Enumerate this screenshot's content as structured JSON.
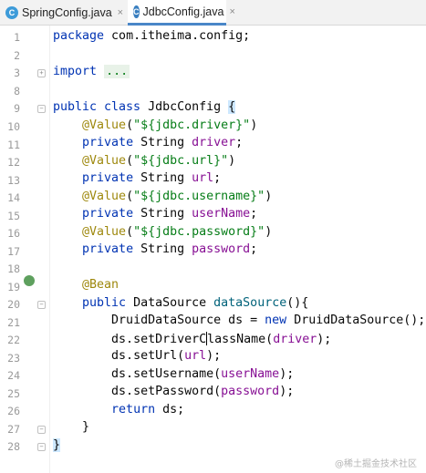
{
  "tabs": [
    {
      "label": "SpringConfig.java",
      "icon": "java-class-icon",
      "close": "×"
    },
    {
      "label": "JdbcConfig.java",
      "icon": "java-class-icon",
      "close": "×",
      "active": true
    }
  ],
  "line_numbers": [
    "1",
    "2",
    "3",
    "8",
    "9",
    "10",
    "11",
    "12",
    "13",
    "14",
    "15",
    "16",
    "17",
    "18",
    "19",
    "20",
    "21",
    "22",
    "23",
    "24",
    "25",
    "26",
    "27",
    "28"
  ],
  "code": {
    "l1": {
      "kw": "package",
      "rest": " com.itheima.config;"
    },
    "l3": {
      "kw": "import",
      "folded": "..."
    },
    "l9": {
      "kw": "public class",
      "name": " JdbcConfig ",
      "brace": "{"
    },
    "l10": {
      "ann": "@Value",
      "p1": "(",
      "str": "\"${jdbc.driver}\"",
      "p2": ")"
    },
    "l11": {
      "kw": "private",
      "type": " String ",
      "field": "driver",
      "end": ";"
    },
    "l12": {
      "ann": "@Value",
      "p1": "(",
      "str": "\"${jdbc.url}\"",
      "p2": ")"
    },
    "l13": {
      "kw": "private",
      "type": " String ",
      "field": "url",
      "end": ";"
    },
    "l14": {
      "ann": "@Value",
      "p1": "(",
      "str": "\"${jdbc.username}\"",
      "p2": ")"
    },
    "l15": {
      "kw": "private",
      "type": " String ",
      "field": "userName",
      "end": ";"
    },
    "l16": {
      "ann": "@Value",
      "p1": "(",
      "str": "\"${jdbc.password}\"",
      "p2": ")"
    },
    "l17": {
      "kw": "private",
      "type": " String ",
      "field": "password",
      "end": ";"
    },
    "l19": {
      "ann": "@Bean"
    },
    "l20": {
      "kw": "public",
      "type": " DataSource ",
      "method": "dataSource",
      "end": "(){"
    },
    "l21": {
      "a": "DruidDataSource ds = ",
      "kw": "new",
      "b": " DruidDataSource();"
    },
    "l22": {
      "a": "ds.setDriverC",
      "b": "lassName(",
      "field": "driver",
      "c": ");"
    },
    "l23": {
      "a": "ds.setUrl(",
      "field": "url",
      "c": ");"
    },
    "l24": {
      "a": "ds.setUsername(",
      "field": "userName",
      "c": ");"
    },
    "l25": {
      "a": "ds.setPassword(",
      "field": "password",
      "c": ");"
    },
    "l26": {
      "kw": "return",
      "a": " ds;"
    },
    "l27": {
      "a": "}"
    },
    "l28": {
      "a": "}"
    }
  },
  "watermark": "@稀土掘金技术社区",
  "colors": {
    "keyword": "#0033b3",
    "annotation": "#9e880d",
    "string": "#067d17",
    "field": "#871094",
    "method": "#00627a"
  }
}
